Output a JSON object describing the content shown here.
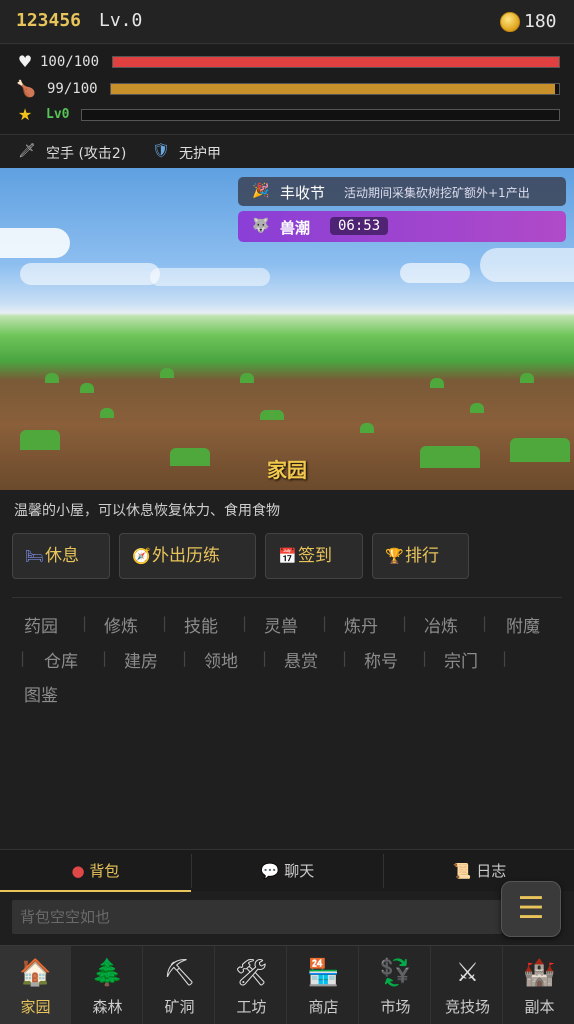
{
  "header": {
    "uid": "123456",
    "level": "Lv.0",
    "coins": "180"
  },
  "stats": {
    "hp": {
      "text": "100/100",
      "value": 1.0,
      "color": "#e04040"
    },
    "food": {
      "text": "99/100",
      "value": 0.99,
      "color": "#c8902a"
    },
    "exp": {
      "text": "Lv0",
      "value": 0.0,
      "color": "#2a7a2a"
    }
  },
  "equipment": {
    "weapon": "空手 (攻击2)",
    "armor": "无护甲"
  },
  "events": [
    {
      "name": "丰收节",
      "desc": "活动期间采集砍树挖矿额外+1产出"
    },
    {
      "name": "兽潮",
      "timer": "06:53"
    }
  ],
  "scene": {
    "title": "家园",
    "description": "温馨的小屋，可以休息恢复体力、食用食物"
  },
  "actions": [
    "休息",
    "外出历练",
    "签到",
    "排行"
  ],
  "links": [
    "药园",
    "修炼",
    "技能",
    "灵兽",
    "炼丹",
    "冶炼",
    "附魔",
    "仓库",
    "建房",
    "领地",
    "悬赏",
    "称号",
    "宗门",
    "图鉴"
  ],
  "tabs": [
    "背包",
    "聊天",
    "日志"
  ],
  "inventory": {
    "empty_text": "背包空空如也"
  },
  "bottom_nav": [
    "家园",
    "森林",
    "矿洞",
    "工坊",
    "商店",
    "市场",
    "竞技场",
    "副本"
  ]
}
